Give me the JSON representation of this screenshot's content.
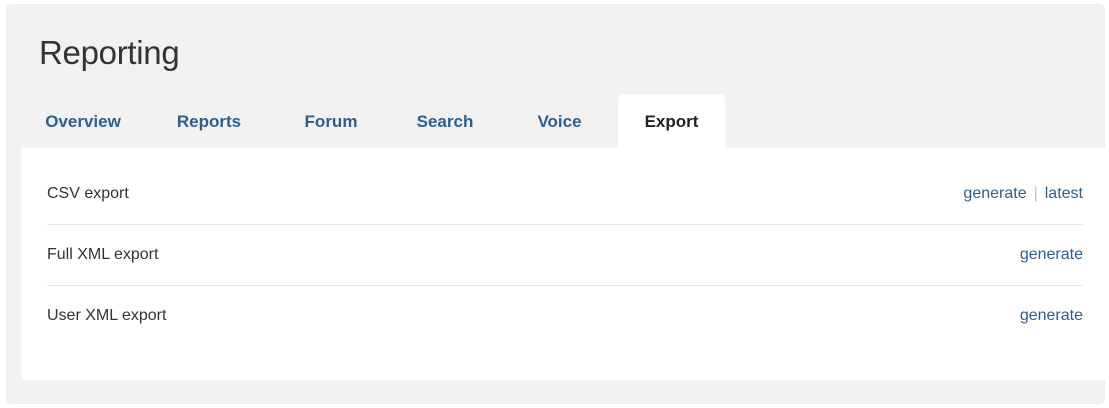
{
  "page": {
    "title": "Reporting"
  },
  "tabs": [
    {
      "label": "Overview",
      "active": false
    },
    {
      "label": "Reports",
      "active": false
    },
    {
      "label": "Forum",
      "active": false
    },
    {
      "label": "Search",
      "active": false
    },
    {
      "label": "Voice",
      "active": false
    },
    {
      "label": "Export",
      "active": true
    }
  ],
  "exports": [
    {
      "label": "CSV export",
      "generate": "generate",
      "separator": "|",
      "latest": "latest"
    },
    {
      "label": "Full XML export",
      "generate": "generate"
    },
    {
      "label": "User XML export",
      "generate": "generate"
    }
  ],
  "colors": {
    "link": "#2d5f8c",
    "background": "#f2f2f2",
    "panel": "#ffffff",
    "text": "#333333"
  }
}
